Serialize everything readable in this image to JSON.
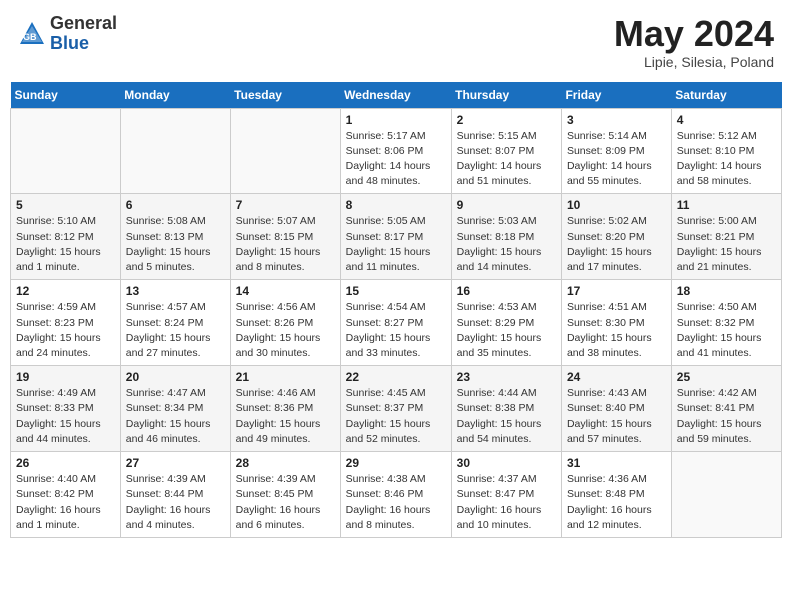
{
  "header": {
    "logo_general": "General",
    "logo_blue": "Blue",
    "month_year": "May 2024",
    "location": "Lipie, Silesia, Poland"
  },
  "weekdays": [
    "Sunday",
    "Monday",
    "Tuesday",
    "Wednesday",
    "Thursday",
    "Friday",
    "Saturday"
  ],
  "weeks": [
    [
      {
        "day": "",
        "info": ""
      },
      {
        "day": "",
        "info": ""
      },
      {
        "day": "",
        "info": ""
      },
      {
        "day": "1",
        "info": "Sunrise: 5:17 AM\nSunset: 8:06 PM\nDaylight: 14 hours\nand 48 minutes."
      },
      {
        "day": "2",
        "info": "Sunrise: 5:15 AM\nSunset: 8:07 PM\nDaylight: 14 hours\nand 51 minutes."
      },
      {
        "day": "3",
        "info": "Sunrise: 5:14 AM\nSunset: 8:09 PM\nDaylight: 14 hours\nand 55 minutes."
      },
      {
        "day": "4",
        "info": "Sunrise: 5:12 AM\nSunset: 8:10 PM\nDaylight: 14 hours\nand 58 minutes."
      }
    ],
    [
      {
        "day": "5",
        "info": "Sunrise: 5:10 AM\nSunset: 8:12 PM\nDaylight: 15 hours\nand 1 minute."
      },
      {
        "day": "6",
        "info": "Sunrise: 5:08 AM\nSunset: 8:13 PM\nDaylight: 15 hours\nand 5 minutes."
      },
      {
        "day": "7",
        "info": "Sunrise: 5:07 AM\nSunset: 8:15 PM\nDaylight: 15 hours\nand 8 minutes."
      },
      {
        "day": "8",
        "info": "Sunrise: 5:05 AM\nSunset: 8:17 PM\nDaylight: 15 hours\nand 11 minutes."
      },
      {
        "day": "9",
        "info": "Sunrise: 5:03 AM\nSunset: 8:18 PM\nDaylight: 15 hours\nand 14 minutes."
      },
      {
        "day": "10",
        "info": "Sunrise: 5:02 AM\nSunset: 8:20 PM\nDaylight: 15 hours\nand 17 minutes."
      },
      {
        "day": "11",
        "info": "Sunrise: 5:00 AM\nSunset: 8:21 PM\nDaylight: 15 hours\nand 21 minutes."
      }
    ],
    [
      {
        "day": "12",
        "info": "Sunrise: 4:59 AM\nSunset: 8:23 PM\nDaylight: 15 hours\nand 24 minutes."
      },
      {
        "day": "13",
        "info": "Sunrise: 4:57 AM\nSunset: 8:24 PM\nDaylight: 15 hours\nand 27 minutes."
      },
      {
        "day": "14",
        "info": "Sunrise: 4:56 AM\nSunset: 8:26 PM\nDaylight: 15 hours\nand 30 minutes."
      },
      {
        "day": "15",
        "info": "Sunrise: 4:54 AM\nSunset: 8:27 PM\nDaylight: 15 hours\nand 33 minutes."
      },
      {
        "day": "16",
        "info": "Sunrise: 4:53 AM\nSunset: 8:29 PM\nDaylight: 15 hours\nand 35 minutes."
      },
      {
        "day": "17",
        "info": "Sunrise: 4:51 AM\nSunset: 8:30 PM\nDaylight: 15 hours\nand 38 minutes."
      },
      {
        "day": "18",
        "info": "Sunrise: 4:50 AM\nSunset: 8:32 PM\nDaylight: 15 hours\nand 41 minutes."
      }
    ],
    [
      {
        "day": "19",
        "info": "Sunrise: 4:49 AM\nSunset: 8:33 PM\nDaylight: 15 hours\nand 44 minutes."
      },
      {
        "day": "20",
        "info": "Sunrise: 4:47 AM\nSunset: 8:34 PM\nDaylight: 15 hours\nand 46 minutes."
      },
      {
        "day": "21",
        "info": "Sunrise: 4:46 AM\nSunset: 8:36 PM\nDaylight: 15 hours\nand 49 minutes."
      },
      {
        "day": "22",
        "info": "Sunrise: 4:45 AM\nSunset: 8:37 PM\nDaylight: 15 hours\nand 52 minutes."
      },
      {
        "day": "23",
        "info": "Sunrise: 4:44 AM\nSunset: 8:38 PM\nDaylight: 15 hours\nand 54 minutes."
      },
      {
        "day": "24",
        "info": "Sunrise: 4:43 AM\nSunset: 8:40 PM\nDaylight: 15 hours\nand 57 minutes."
      },
      {
        "day": "25",
        "info": "Sunrise: 4:42 AM\nSunset: 8:41 PM\nDaylight: 15 hours\nand 59 minutes."
      }
    ],
    [
      {
        "day": "26",
        "info": "Sunrise: 4:40 AM\nSunset: 8:42 PM\nDaylight: 16 hours\nand 1 minute."
      },
      {
        "day": "27",
        "info": "Sunrise: 4:39 AM\nSunset: 8:44 PM\nDaylight: 16 hours\nand 4 minutes."
      },
      {
        "day": "28",
        "info": "Sunrise: 4:39 AM\nSunset: 8:45 PM\nDaylight: 16 hours\nand 6 minutes."
      },
      {
        "day": "29",
        "info": "Sunrise: 4:38 AM\nSunset: 8:46 PM\nDaylight: 16 hours\nand 8 minutes."
      },
      {
        "day": "30",
        "info": "Sunrise: 4:37 AM\nSunset: 8:47 PM\nDaylight: 16 hours\nand 10 minutes."
      },
      {
        "day": "31",
        "info": "Sunrise: 4:36 AM\nSunset: 8:48 PM\nDaylight: 16 hours\nand 12 minutes."
      },
      {
        "day": "",
        "info": ""
      }
    ]
  ]
}
